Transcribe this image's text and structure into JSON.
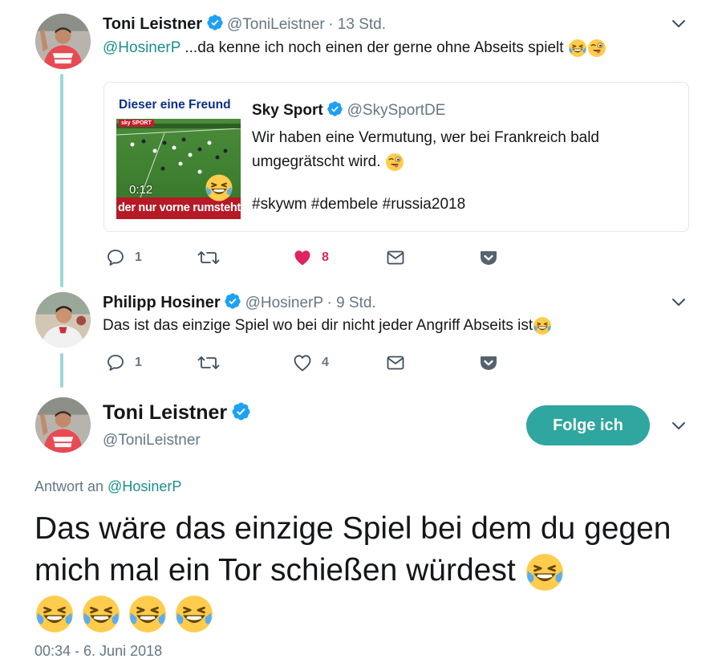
{
  "tweet1": {
    "name": "Toni Leistner",
    "handle": "@ToniLeistner",
    "time": "· 13 Std.",
    "mention": "@HosinerP",
    "text": " ...da kenne ich noch einen der gerne ohne Abseits spielt"
  },
  "quoted": {
    "name": "Sky Sport",
    "handle": "@SkySportDE",
    "text": "Wir haben eine Vermutung, wer bei Frankreich bald umgegrätscht wird.",
    "hashtags": "#skywm #dembele #russia2018",
    "thumb_top": "Dieser eine Freund",
    "thumb_bottom": "der nur vorne rumsteht",
    "thumb_time": "0:12",
    "thumb_brand": "sky SPORT"
  },
  "tweet1_actions": {
    "replies": "1",
    "likes": "8"
  },
  "tweet2": {
    "name": "Philipp Hosiner",
    "handle": "@HosinerP",
    "time": "· 9 Std.",
    "text": "Das ist das einzige Spiel wo bei dir nicht jeder Angriff Abseits ist"
  },
  "tweet2_actions": {
    "replies": "1",
    "likes": "4"
  },
  "main": {
    "name": "Toni Leistner",
    "handle": "@ToniLeistner",
    "follow_label": "Folge ich",
    "reply_prefix": "Antwort an ",
    "reply_to": "@HosinerP",
    "text": "Das wäre das einzige Spiel bei dem du gegen mich mal ein Tor schießen würdest",
    "timestamp": "00:34 - 6. Juni 2018"
  },
  "colors": {
    "accent": "#1b8f8a",
    "thread": "#9ed8d2",
    "like": "#e0245e",
    "muted": "#657786"
  }
}
